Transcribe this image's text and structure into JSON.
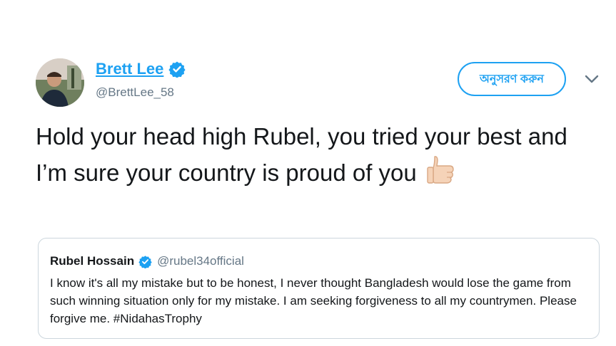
{
  "author": {
    "display_name": "Brett Lee",
    "handle": "@BrettLee_58",
    "verified": true,
    "avatar_icon": "avatar-photo"
  },
  "follow_button": {
    "label": "অনুসরণ করুন"
  },
  "menu_icon": "chevron-down-icon",
  "tweet": {
    "text": "Hold your head high Rubel, you tried your best and I’m sure your country is proud of you",
    "emoji_icon": "thumbs-up-icon"
  },
  "quoted_tweet": {
    "display_name": "Rubel Hossain",
    "verified": true,
    "handle": "@rubel34official",
    "text": "I know it's all my mistake but to be honest, I never thought Bangladesh would lose the game from such winning situation only for my mistake. I am seeking forgiveness to all my countrymen. Please forgive me. #NidahasTrophy"
  },
  "colors": {
    "accent": "#1da1f2",
    "text": "#14171a",
    "secondary_text": "#657786",
    "border": "#ccd6dd"
  }
}
